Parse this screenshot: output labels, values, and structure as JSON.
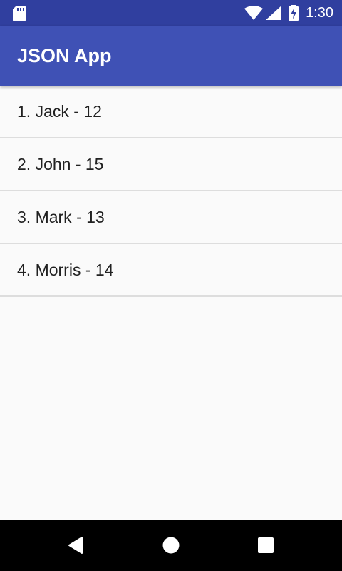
{
  "status_bar": {
    "time": "1:30",
    "icons": [
      "sd-card-icon",
      "wifi-icon",
      "signal-icon",
      "battery-charging-icon"
    ]
  },
  "app_bar": {
    "title": "JSON App",
    "color": "#3f51b5"
  },
  "list": {
    "items": [
      {
        "label": "1. Jack - 12"
      },
      {
        "label": "2. John - 15"
      },
      {
        "label": "3. Mark - 13"
      },
      {
        "label": "4. Morris - 14"
      }
    ]
  },
  "nav_bar": {
    "icons": [
      "back-icon",
      "home-icon",
      "recents-icon"
    ]
  }
}
